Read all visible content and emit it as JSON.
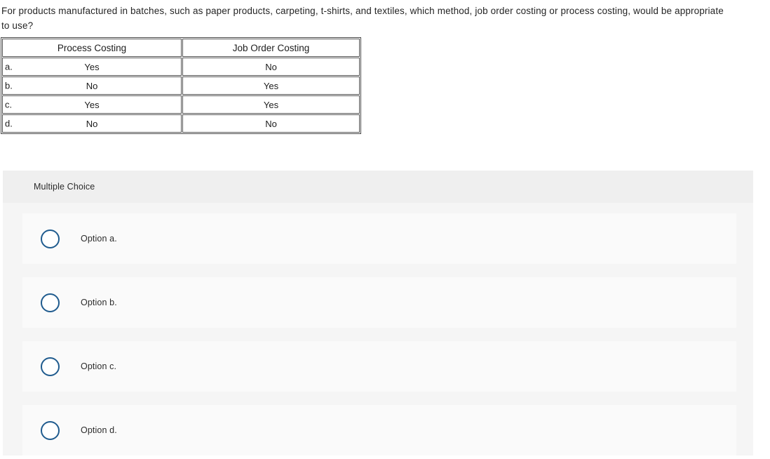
{
  "question": {
    "stem": "For products manufactured in batches, such as paper products, carpeting, t-shirts, and textiles, which method, job order costing or process costing, would be appropriate to use?"
  },
  "choice_table": {
    "headers": {
      "letter": "",
      "process_costing": "Process Costing",
      "job_order_costing": "Job Order Costing"
    },
    "rows": [
      {
        "letter": "a.",
        "process_costing": "Yes",
        "job_order_costing": "No"
      },
      {
        "letter": "b.",
        "process_costing": "No",
        "job_order_costing": "Yes"
      },
      {
        "letter": "c.",
        "process_costing": "Yes",
        "job_order_costing": "Yes"
      },
      {
        "letter": "d.",
        "process_costing": "No",
        "job_order_costing": "No"
      }
    ]
  },
  "multiple_choice": {
    "header_label": "Multiple Choice",
    "options": [
      {
        "label": "Option a.",
        "selected": false
      },
      {
        "label": "Option b.",
        "selected": false
      },
      {
        "label": "Option c.",
        "selected": false
      },
      {
        "label": "Option d.",
        "selected": false
      }
    ]
  },
  "colors": {
    "text": "#252525",
    "panel_header_bg": "#efefef",
    "panel_bg": "#f5f5f5",
    "option_bg": "#fafafa",
    "radio_border": "#1f5b8e",
    "table_border": "#555555"
  }
}
